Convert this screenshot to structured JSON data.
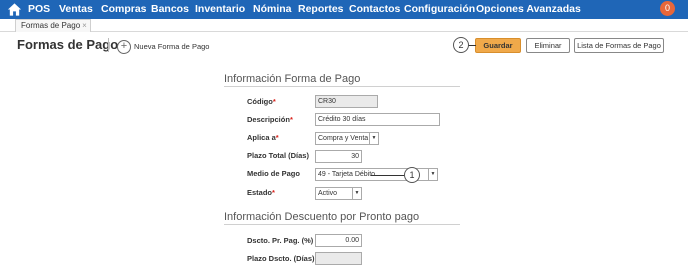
{
  "nav": {
    "items": [
      "POS",
      "Ventas",
      "Compras",
      "Bancos",
      "Inventario",
      "Nómina",
      "Reportes",
      "Contactos",
      "Configuración",
      "Opciones Avanzadas"
    ],
    "notification_count": "0"
  },
  "tab": {
    "label": "Formas de Pago",
    "close": "×"
  },
  "header": {
    "title": "Formas de Pago",
    "new_label": "Nueva Forma de Pago",
    "save_label": "Guardar",
    "delete_label": "Eliminar",
    "list_label": "Lista de Formas de Pago"
  },
  "callouts": {
    "first": "1",
    "second": "2"
  },
  "section1": {
    "title": "Información Forma de Pago",
    "codigo_label": "Código",
    "codigo_value": "CR30",
    "descripcion_label": "Descripción",
    "descripcion_value": "Crédito 30 días",
    "aplica_label": "Aplica a",
    "aplica_value": "Compra y Venta",
    "plazo_label": "Plazo Total (Días)",
    "plazo_value": "30",
    "medio_label": "Medio de Pago",
    "medio_value": "49 - Tarjeta Débito",
    "estado_label": "Estado",
    "estado_value": "Activo",
    "required_mark": "*"
  },
  "section2": {
    "title": "Información Descuento por Pronto pago",
    "dscto_label": "Dscto. Pr. Pag. (%)",
    "dscto_value": "0.00",
    "plazo_dscto_label": "Plazo Dscto. (Días)",
    "plazo_dscto_value": ""
  },
  "colors": {
    "nav_bg": "#1f66b7",
    "primary_btn": "#f0a94a",
    "badge": "#e8673a",
    "required": "#d9231c"
  }
}
